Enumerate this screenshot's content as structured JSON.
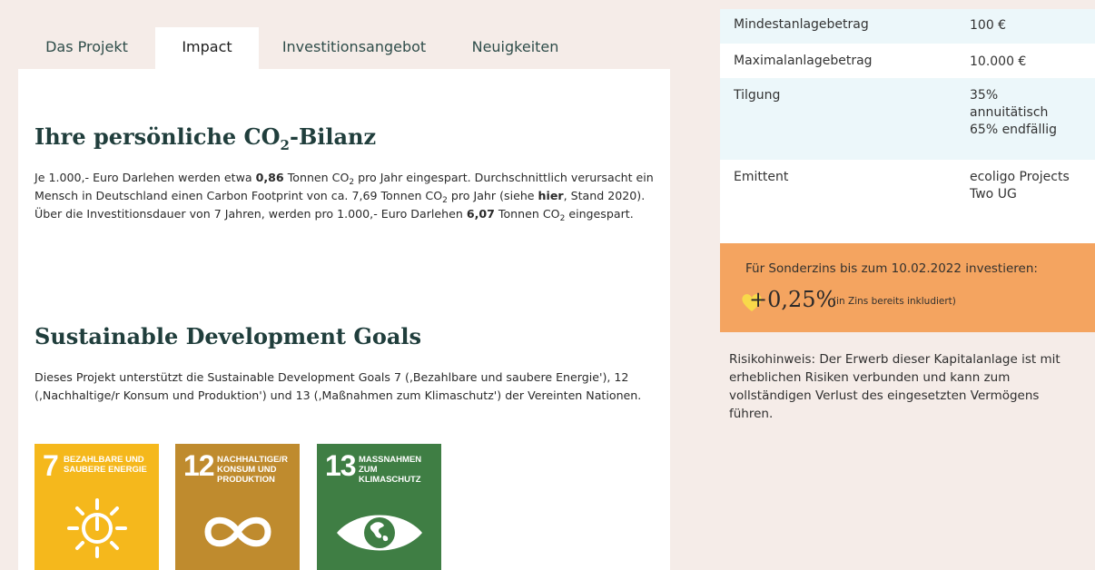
{
  "tabs": [
    {
      "label": "Das Projekt",
      "active": false
    },
    {
      "label": "Impact",
      "active": true
    },
    {
      "label": "Investitionsangebot",
      "active": false
    },
    {
      "label": "Neuigkeiten",
      "active": false
    }
  ],
  "co2": {
    "heading_pre": "Ihre persönliche CO",
    "heading_sub": "2",
    "heading_post": "-Bilanz",
    "p1": "Je 1.000,- Euro Darlehen werden etwa ",
    "p1_bold": "0,86",
    "p2": " Tonnen CO",
    "sub2": "2",
    "p3": " pro Jahr eingespart. Durchschnittlich verursacht ein Mensch in Deutschland einen Carbon Footprint von ca. 7,69 Tonnen CO",
    "sub3": "2",
    "p4": " pro Jahr (siehe ",
    "link": "hier",
    "p5": ", Stand 2020). Über die Investitionsdauer von 7 Jahren, werden pro 1.000,- Euro Darlehen ",
    "p5_bold": "6,07",
    "p6": " Tonnen CO",
    "sub6": "2",
    "p7": " eingespart."
  },
  "sdg_section": {
    "heading": "Sustainable Development Goals",
    "text": "Dieses Projekt unterstützt die Sustainable Development Goals 7 (‚Bezahlbare und saubere Energie'), 12 (‚Nachhaltige/r Konsum und Produktion') und 13 (‚Maßnahmen zum Klimaschutz') der Vereinten Nationen.",
    "tiles": [
      {
        "number": "7",
        "title": "Bezahlbare und saubere Energie",
        "color": "#f5b81c",
        "icon": "sun-power-icon"
      },
      {
        "number": "12",
        "title": "Nachhaltige/r Konsum und Produktion",
        "color": "#bf8b2e",
        "icon": "infinity-loop-icon"
      },
      {
        "number": "13",
        "title": "Maßnahmen zum Klimaschutz",
        "color": "#3f7e44",
        "icon": "eye-globe-icon"
      }
    ]
  },
  "details": [
    {
      "key": "Mindestanlagebetrag",
      "value": "100 €",
      "bg": "#ecf7fa"
    },
    {
      "key": "Maximalanlagebetrag",
      "value": "10.000 €",
      "bg": "#ffffff"
    },
    {
      "key": "Tilgung",
      "value": "35% annuitätisch 65% endfällig",
      "bg": "#ecf7fa"
    },
    {
      "key": "Emittent",
      "value": "ecoligo Projects Two UG",
      "bg": "#ffffff"
    }
  ],
  "promo": {
    "text": "Für Sonderzins bis zum 10.02.2022 investieren:",
    "rate": "+0,25%",
    "note": "(in Zins bereits inkludiert)",
    "bg_color": "#f4a460",
    "heart_color": "#f8d94a"
  },
  "risk": "Risikohinweis: Der Erwerb dieser Kapitalanlage ist mit erheblichen Risiken verbunden und kann zum vollständigen Verlust des eingesetzten Vermögens führen."
}
